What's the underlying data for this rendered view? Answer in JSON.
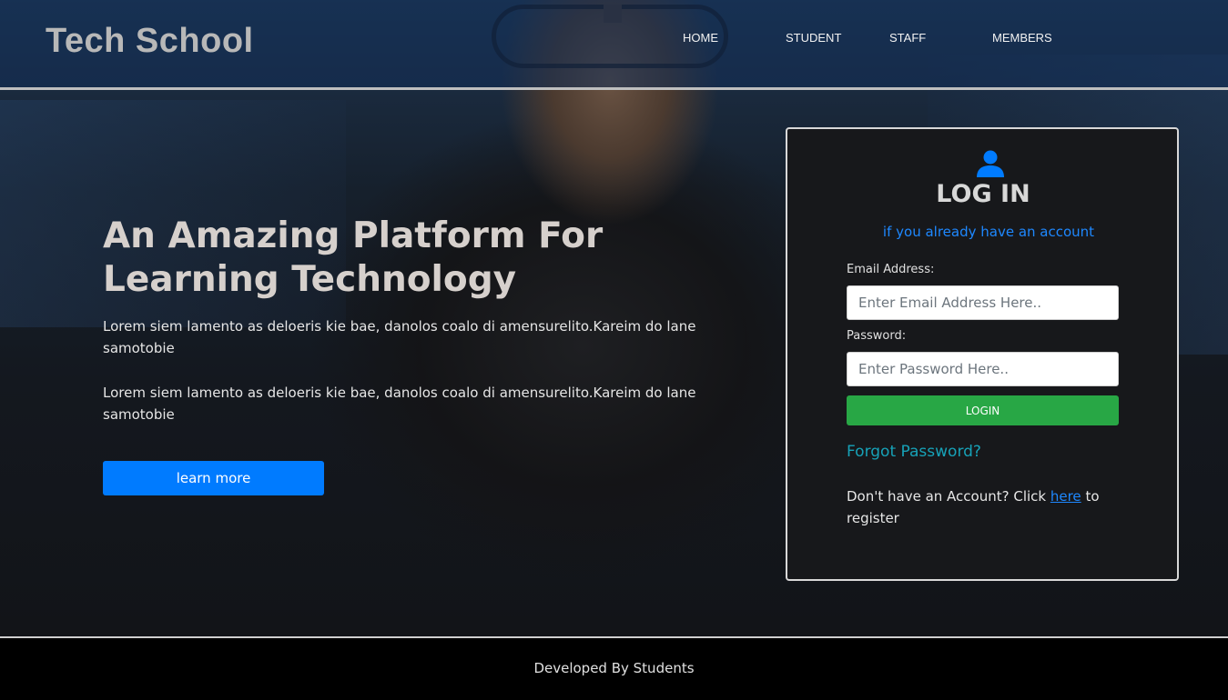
{
  "brand": {
    "title": "Tech School"
  },
  "nav": {
    "home": "HOME",
    "student": "STUDENT",
    "staff": "STAFF",
    "members": "MEMBERS"
  },
  "hero": {
    "title": "An Amazing Platform For Learning Technology",
    "paragraph1": "Lorem siem lamento as deloeris kie bae, danolos coalo di amensurelito.Kareim do lane samotobie",
    "paragraph2": "Lorem siem lamento as deloeris kie bae, danolos coalo di amensurelito.Kareim do lane samotobie",
    "button_label": "learn more"
  },
  "login": {
    "icon": "user-icon",
    "title": "LOG IN",
    "subtitle": "if you already have an account",
    "email_label": "Email Address:",
    "email_placeholder": "Enter Email Address Here..",
    "password_label": "Password:",
    "password_placeholder": "Enter Password Here..",
    "button_label": "LOGIN",
    "forgot_label": "Forgot Password?",
    "register_prefix": "Don't have an Account? Click ",
    "register_link": "here",
    "register_suffix": " to register"
  },
  "footer": {
    "text": "Developed By Students"
  },
  "colors": {
    "accent_blue": "#007bff",
    "login_green": "#28a745",
    "forgot_teal": "#17a2b8"
  }
}
